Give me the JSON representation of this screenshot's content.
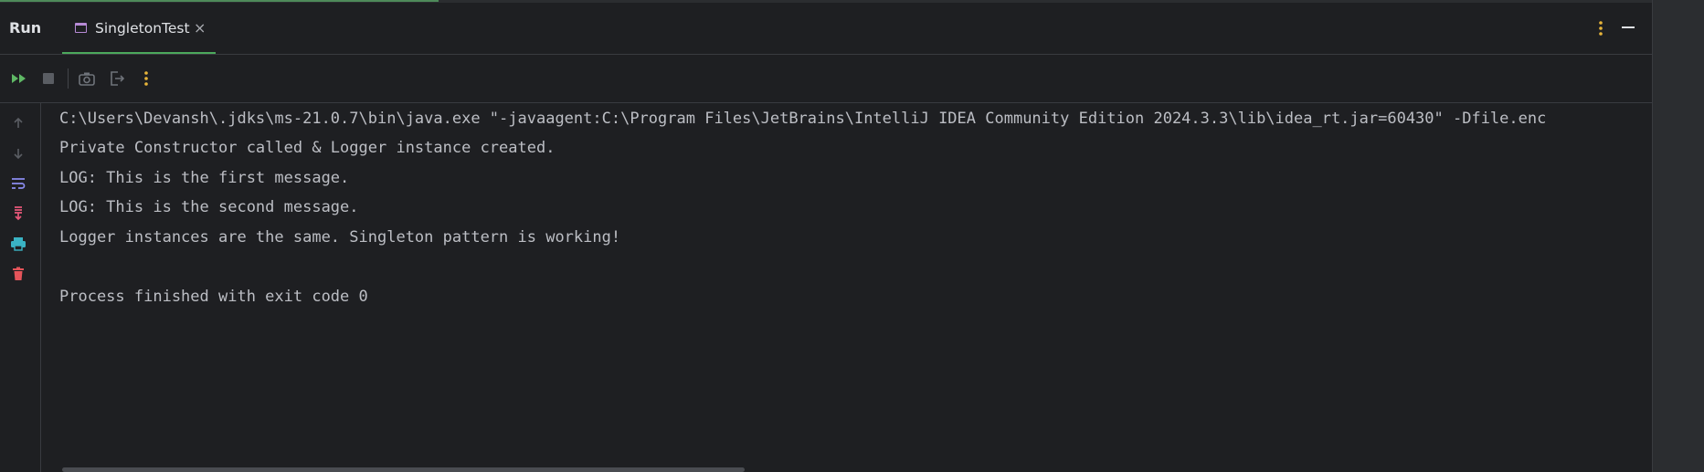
{
  "header": {
    "run_label": "Run",
    "tab_label": "SingletonTest",
    "tab_close": "×"
  },
  "toolbar": {
    "rerun_icon": "double-play-icon",
    "stop_icon": "stop-icon",
    "screenshot_icon": "camera-icon",
    "exit_icon": "exit-icon",
    "more_icon": "vertical-dots-icon"
  },
  "gutter": {
    "icons": [
      "arrow-up-icon",
      "arrow-down-icon",
      "soft-wrap-icon",
      "scroll-to-end-icon",
      "print-icon",
      "trash-icon"
    ]
  },
  "console": {
    "lines": [
      "C:\\Users\\Devansh\\.jdks\\ms-21.0.7\\bin\\java.exe \"-javaagent:C:\\Program Files\\JetBrains\\IntelliJ IDEA Community Edition 2024.3.3\\lib\\idea_rt.jar=60430\" -Dfile.enc",
      "Private Constructor called & Logger instance created.",
      "LOG: This is the first message.",
      "LOG: This is the second message.",
      "Logger instances are the same. Singleton pattern is working!",
      "",
      "Process finished with exit code 0"
    ]
  },
  "colors": {
    "accent_green": "#4ca95c",
    "rerun_green": "#5fb865",
    "amber": "#e8b53a",
    "wrap_purple": "#8b8cf0",
    "scroll_pink": "#e8577a",
    "print_teal": "#3ab3c4",
    "trash_red": "#e5545a"
  }
}
